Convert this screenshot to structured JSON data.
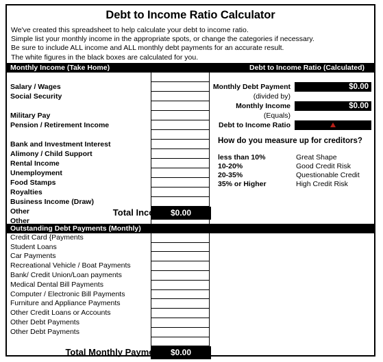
{
  "title": "Debt to Income Ratio Calculator",
  "intro": [
    "We've created this spreadsheet to help calculate your debt to income ratio.",
    "Simple list your monthly income in the appropriate spots, or change the categories if necessary.",
    "Be sure to include ALL income and ALL monthly debt payments for an accurate result.",
    "The white figures in the black boxes are calculated for you."
  ],
  "section_headers": {
    "income": "Monthly Income (Take Home)",
    "ratio": "Debt to Income Ratio (Calculated)",
    "debt": "Outstanding Debt Payments (Monthly)"
  },
  "income": {
    "rows": [
      {
        "label": "Salary / Wages",
        "value": ""
      },
      {
        "label": "Social Security",
        "value": ""
      },
      {
        "label": "Military Pay",
        "value": ""
      },
      {
        "label": "Pension  / Retirement Income",
        "value": ""
      },
      {
        "label": "Bank and Investment Interest",
        "value": ""
      },
      {
        "label": "Alimony / Child Support",
        "value": ""
      },
      {
        "label": "Rental Income",
        "value": ""
      },
      {
        "label": "Unemployment",
        "value": ""
      },
      {
        "label": "Food Stamps",
        "value": ""
      },
      {
        "label": "Royalties",
        "value": ""
      },
      {
        "label": "Business Income (Draw)",
        "value": ""
      },
      {
        "label": "Other",
        "value": ""
      },
      {
        "label": "Other",
        "value": ""
      }
    ],
    "total_label": "Total Income",
    "total_value": "$0.00"
  },
  "calculated": {
    "monthly_debt_payment_label": "Monthly Debt Payment",
    "monthly_debt_payment_value": "$0.00",
    "divided_by_label": "(divided by)",
    "monthly_income_label": "Monthly Income",
    "monthly_income_value": "$0.00",
    "equals_label": "(Equals)",
    "ratio_label": "Debt to Income Ratio",
    "ratio_value": "",
    "ratio_flag_color": "#b52018"
  },
  "creditors": {
    "title": "How do you measure up for creditors?",
    "rows": [
      {
        "range": "less than 10%",
        "rating": "Great Shape"
      },
      {
        "range": "10-20%",
        "rating": "Good Credit Risk"
      },
      {
        "range": "20-35%",
        "rating": "Questionable Credit"
      },
      {
        "range": "35% or Higher",
        "rating": "High Credit Risk"
      }
    ]
  },
  "debt": {
    "rows": [
      {
        "label": "Credit Card {Payments",
        "value": ""
      },
      {
        "label": "Student Loans",
        "value": ""
      },
      {
        "label": "Car Payments",
        "value": ""
      },
      {
        "label": "Recreational Vehicle / Boat Payments",
        "value": ""
      },
      {
        "label": "Bank/ Credit Union/Loan payments",
        "value": ""
      },
      {
        "label": "Medical Dental Bill Payments",
        "value": ""
      },
      {
        "label": "Computer / Electronic Bill Payments",
        "value": ""
      },
      {
        "label": "Furniture and Appliance Payments",
        "value": ""
      },
      {
        "label": "Other Credit Loans or Accounts",
        "value": ""
      },
      {
        "label": "Other Debt Payments",
        "value": ""
      },
      {
        "label": "Other Debt Payments",
        "value": ""
      }
    ],
    "total_label": "Total Monthly Payments",
    "total_value": "$0.00"
  }
}
